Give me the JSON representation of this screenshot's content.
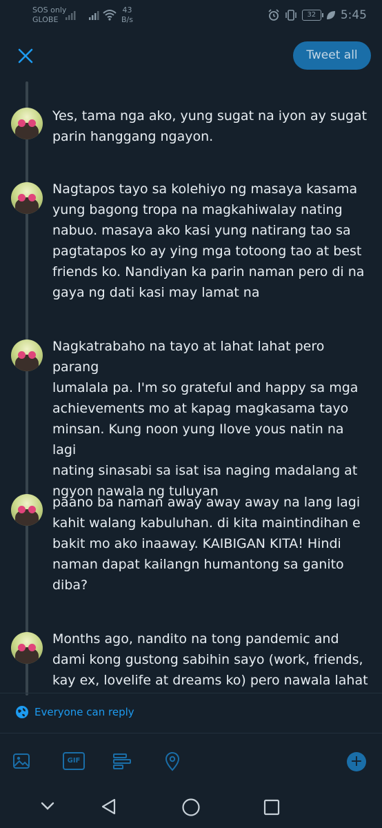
{
  "status_bar": {
    "carrier_line1": "SOS only",
    "carrier_line2": "GLOBE",
    "speed_value": "43",
    "speed_unit": "B/s",
    "battery": "32",
    "time": "5:45"
  },
  "header": {
    "tweet_all_label": "Tweet all"
  },
  "thread": [
    {
      "text": "Yes, tama nga ako, yung sugat na iyon ay sugat\nparin hanggang ngayon."
    },
    {
      "text": "Nagtapos tayo sa kolehiyo ng masaya kasama\nyung bagong tropa na magkahiwalay nating\nnabuo. masaya ako kasi yung natirang tao sa\npagtatapos ko ay ying mga totoong tao at best\nfriends ko. Nandiyan ka parin naman pero di na\ngaya ng dati kasi may lamat na"
    },
    {
      "text": "Nagkatrabaho na tayo at lahat lahat pero parang\nlumalala pa. I'm so grateful and happy sa mga\nachievements mo at kapag magkasama tayo\nminsan. Kung noon yung Ilove yous natin na lagi\nnating sinasabi sa isat isa naging madalang at\nngyon nawala ng tuluyan"
    },
    {
      "text": "paano ba naman away away away na lang lagi\nkahit walang kabuluhan. di kita maintindihan e\nbakit mo ako inaaway. KAIBIGAN KITA! Hindi\nnaman dapat kailangn humantong sa ganito\ndiba?"
    },
    {
      "text": "Months ago, nandito na tong pandemic and\ndami kong gustong sabihin sayo (work, friends,\nkay ex, lovelife at dreams ko) pero nawala lahat"
    }
  ],
  "reply_setting": {
    "label": "Everyone can reply"
  },
  "toolbar": {
    "gif_label": "GIF"
  },
  "colors": {
    "background": "#15202b",
    "accent": "#1d9bf0",
    "button": "#1a6ea8"
  }
}
